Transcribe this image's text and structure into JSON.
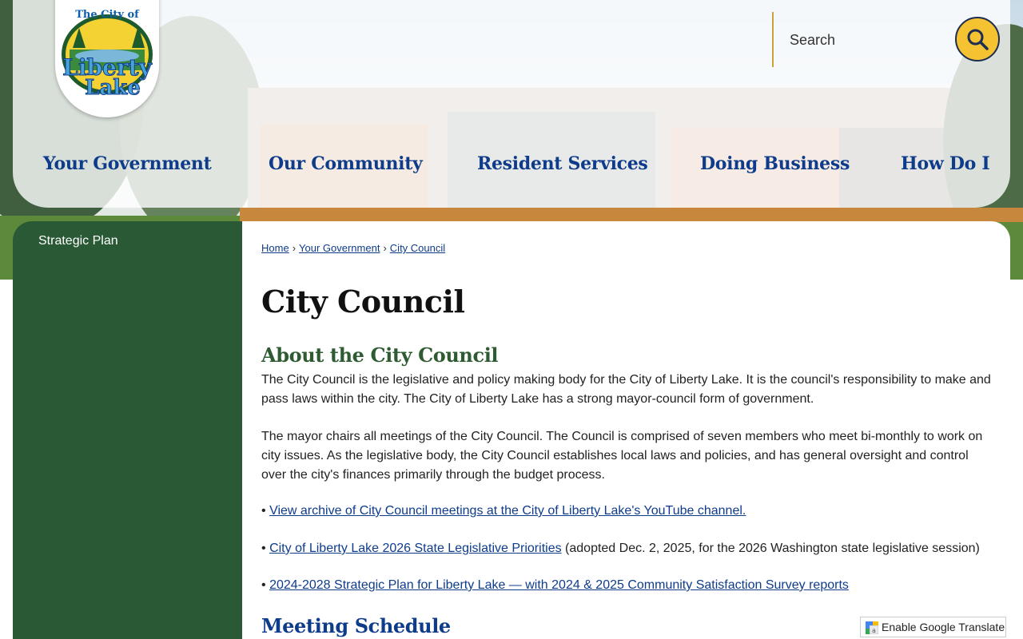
{
  "logo": {
    "line1": "The City of",
    "line2": "Liberty",
    "line3": "Lake"
  },
  "search": {
    "placeholder": "Search"
  },
  "nav": {
    "items": [
      {
        "label": "Your Government"
      },
      {
        "label": "Our Community"
      },
      {
        "label": "Resident Services"
      },
      {
        "label": "Doing Business"
      },
      {
        "label": "How Do I"
      }
    ]
  },
  "sidebar": {
    "items": [
      {
        "label": "Strategic Plan"
      }
    ]
  },
  "breadcrumb": {
    "items": [
      {
        "label": "Home"
      },
      {
        "label": "Your Government"
      },
      {
        "label": "City Council"
      }
    ],
    "separator": "›"
  },
  "page": {
    "title": "City Council",
    "about_heading": "About the City Council",
    "para1": "The City Council is the legislative and policy making body for the City of Liberty Lake. It is the council's responsibility to make and pass laws within the city. The City of Liberty Lake has a strong mayor-council form of government.",
    "para2": "The mayor chairs all meetings of the City Council. The Council is comprised of seven members who meet bi-monthly to work on city issues. As the legislative body, the City Council establishes local laws and policies, and has general oversight and control over the city's finances primarily through the budget process.",
    "bullet_char": "•",
    "links": [
      {
        "label": "View archive of City Council meetings at the City of Liberty Lake's YouTube channel.",
        "suffix": ""
      },
      {
        "label": "City of Liberty Lake 2026 State Legislative Priorities",
        "suffix": " (adopted Dec. 2, 2025, for the 2026 Washington state legislative session)"
      },
      {
        "label": "2024-2028 Strategic Plan for Liberty Lake — with 2024 & 2025 Community Satisfaction Survey reports",
        "suffix": ""
      }
    ],
    "meeting_heading": "Meeting Schedule"
  },
  "translate": {
    "label": "Enable Google Translate"
  },
  "colors": {
    "nav_blue": "#0e3c8b",
    "sidebar_green": "#295a35",
    "heading_green": "#2f5b33",
    "search_yellow": "#f5c231"
  }
}
